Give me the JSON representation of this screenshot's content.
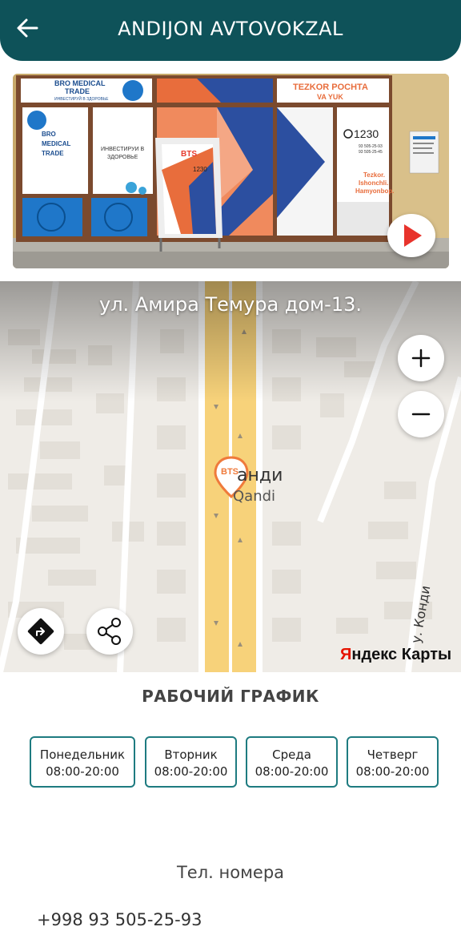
{
  "header": {
    "title": "ANDIJON AVTOVOKZAL",
    "back_icon": "arrow-left-icon",
    "background": "#0e5259"
  },
  "photo": {
    "signs": {
      "left_brand_1": "BRO MEDICAL",
      "left_brand_2": "TRADE",
      "left_slogan": "ИНВЕСТИРУЙ В ЗДОРОВЬЕ",
      "left_panel_brand_1": "BRO",
      "left_panel_brand_2": "MEDICAL",
      "left_panel_brand_3": "TRADE",
      "door_text_1": "ИНВЕСТИРУИ В",
      "door_text_2": "ЗДОРОВЬЕ",
      "stand_logo": "BTS",
      "stand_phone": "1230",
      "right_sign_1": "TEZKOR POCHTA",
      "right_sign_2": "VA YUK",
      "right_phone": "1230",
      "right_number_1": "93 505-25-93",
      "right_number_2": "93 505-25-45",
      "right_slogan_1": "Tezkor.",
      "right_slogan_2": "Ishonchli.",
      "right_slogan_3": "Hamyonbop."
    },
    "play_icon": "play-icon"
  },
  "map": {
    "address": "ул. Амира Темура дом-13.",
    "poi_name_ru": "анди",
    "poi_name_uz": "Qandi",
    "poi_marker_label": "BTS",
    "street_label": "у. Конди",
    "provider": {
      "first": "Я",
      "rest": "ндекс Карты"
    },
    "zoom_in_icon": "plus-icon",
    "zoom_out_icon": "minus-icon",
    "directions_icon": "directions-icon",
    "share_icon": "share-icon"
  },
  "schedule": {
    "title": "РАБОЧИЙ ГРАФИК",
    "days": [
      {
        "name": "Понедельник",
        "hours": "08:00-20:00"
      },
      {
        "name": "Вторник",
        "hours": "08:00-20:00"
      },
      {
        "name": "Среда",
        "hours": "08:00-20:00"
      },
      {
        "name": "Четверг",
        "hours": "08:00-20:00"
      }
    ],
    "card_border_color": "#1e7b80"
  },
  "contacts": {
    "title": "Тел. номера",
    "phones": [
      "+998 93 505-25-93"
    ]
  }
}
